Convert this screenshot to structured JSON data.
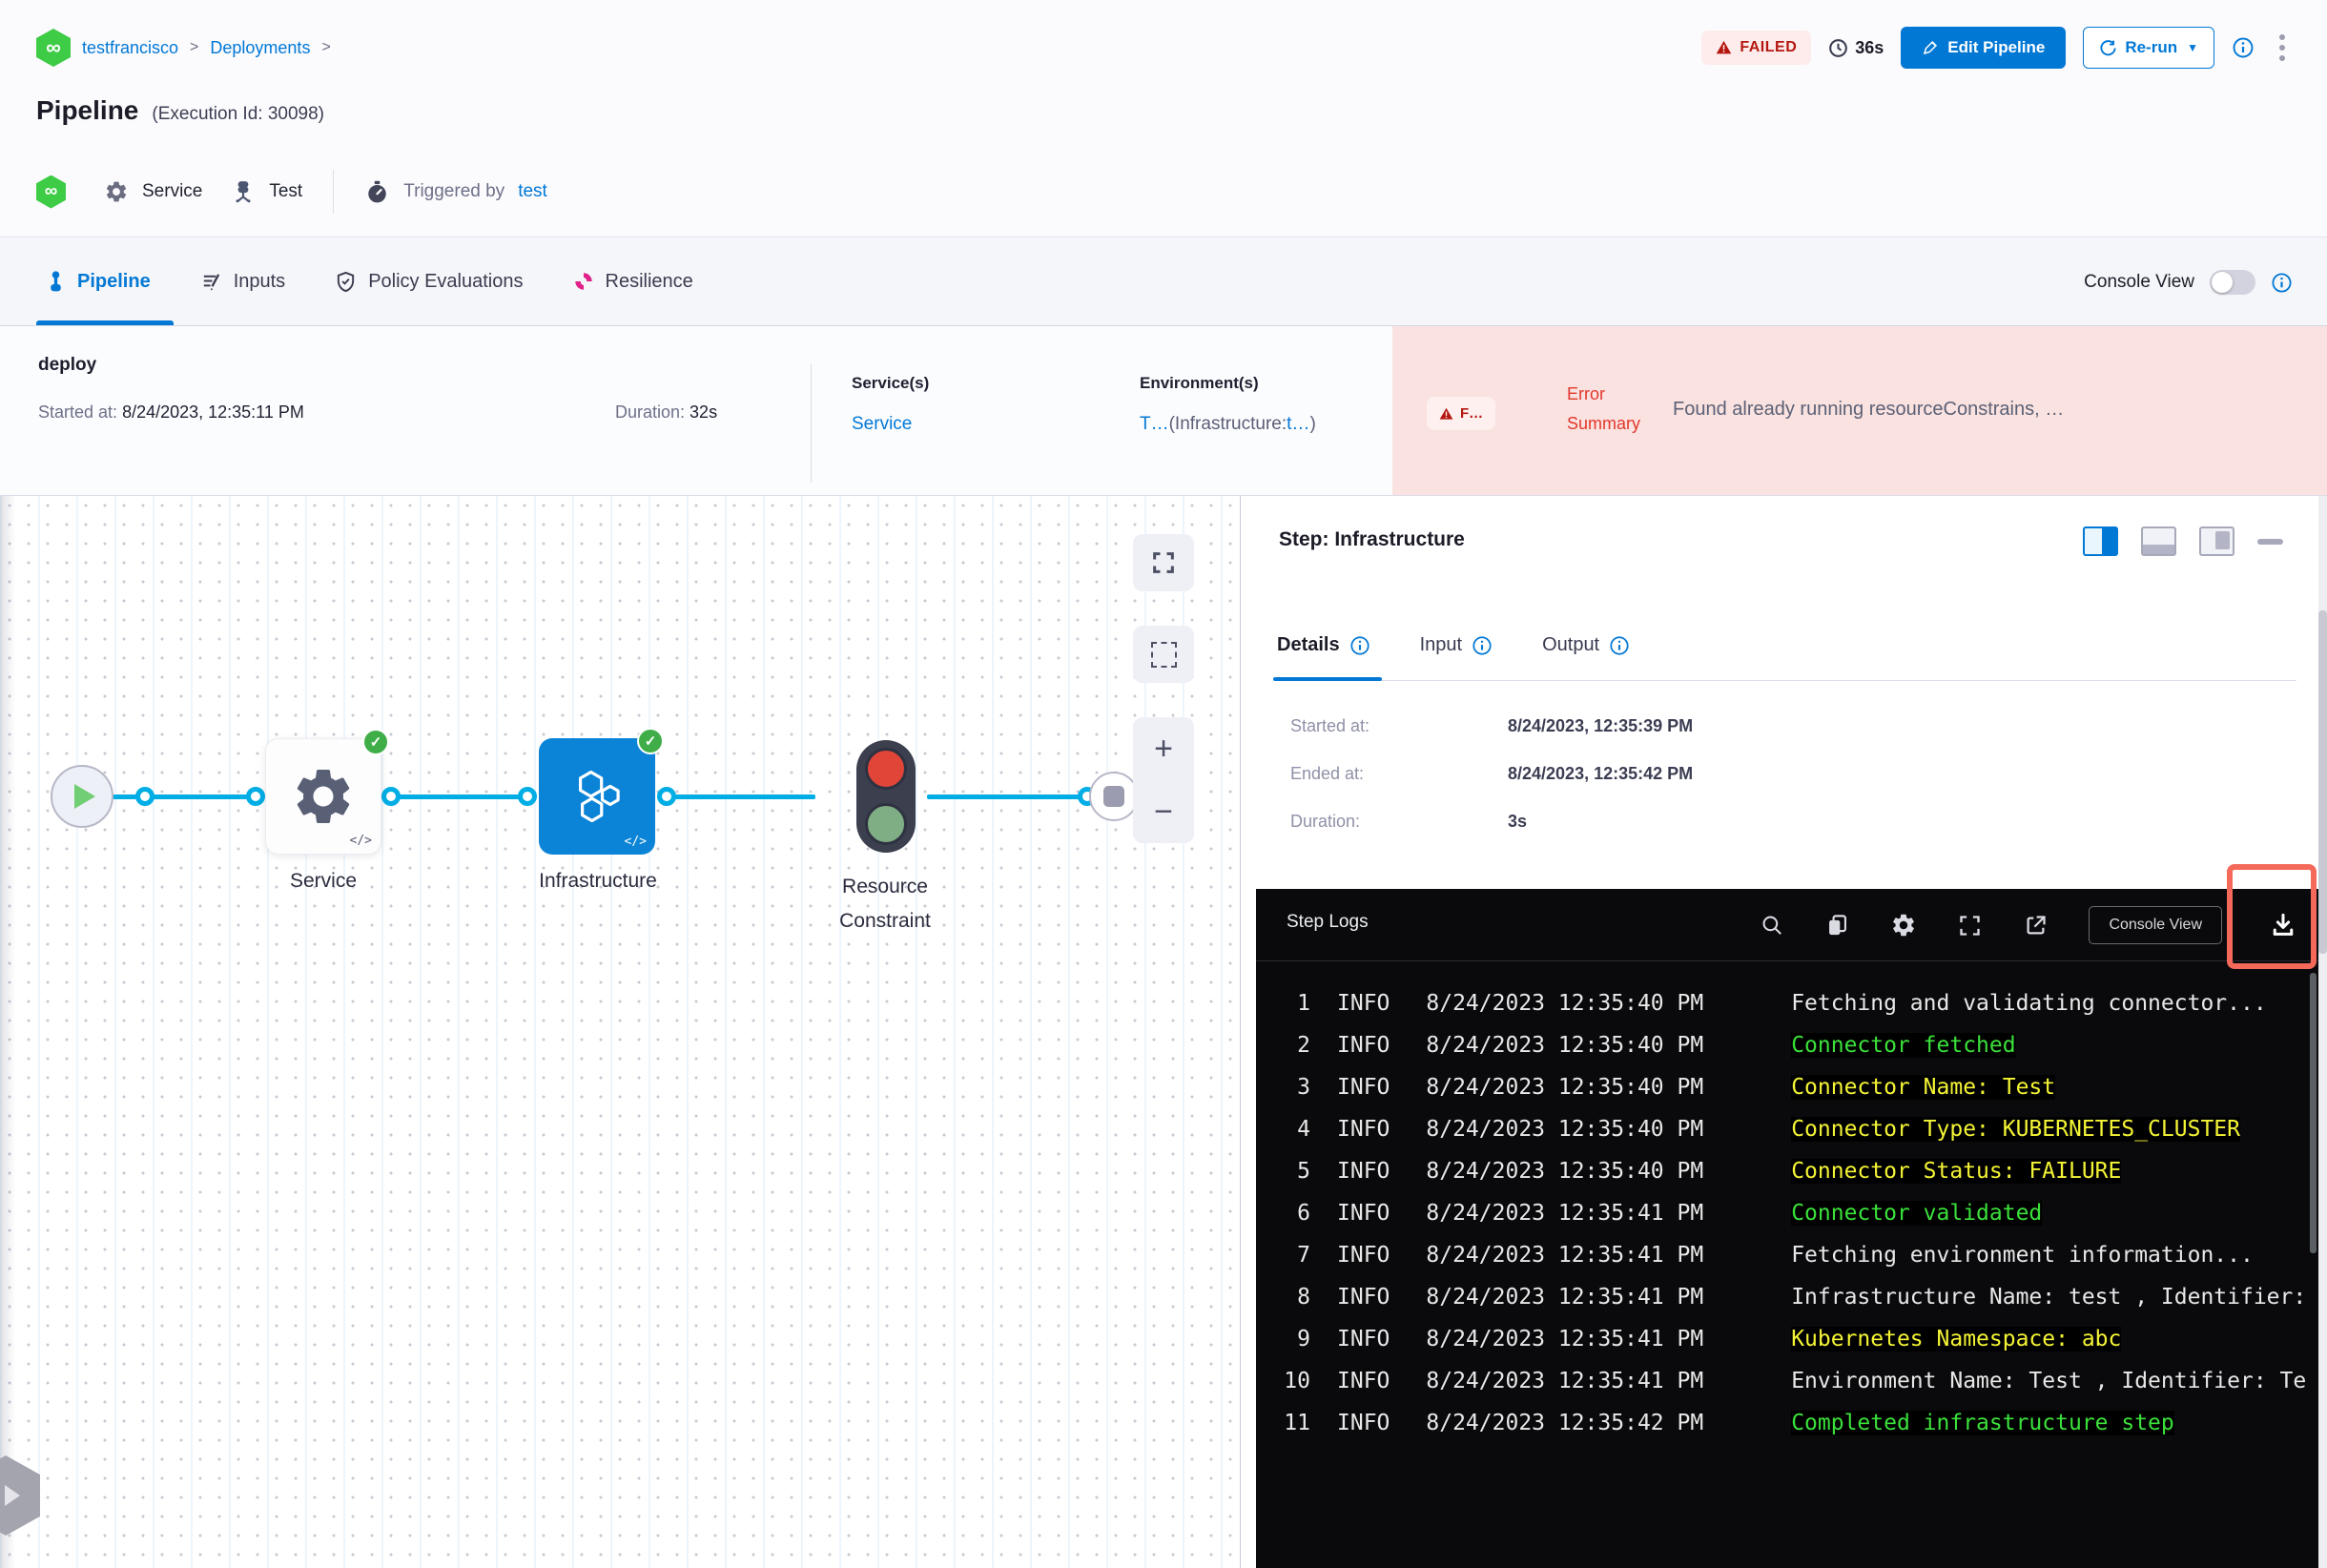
{
  "breadcrumb": {
    "items": [
      "testfrancisco",
      "Deployments"
    ],
    "separator": ">",
    "logo_icon": "harness-infinity-icon"
  },
  "header": {
    "title": "Pipeline",
    "execution_id": "(Execution Id: 30098)",
    "service_label": "Service",
    "environment_label": "Test",
    "triggered_by_prefix": "Triggered by",
    "triggered_by_user": "test",
    "status_badge": "FAILED",
    "total_duration": "36s",
    "edit_button": "Edit Pipeline",
    "rerun_button": "Re-run"
  },
  "tabs": {
    "items": [
      {
        "label": "Pipeline",
        "active": true
      },
      {
        "label": "Inputs",
        "active": false
      },
      {
        "label": "Policy Evaluations",
        "active": false
      },
      {
        "label": "Resilience",
        "active": false
      }
    ],
    "console_view_label": "Console View",
    "console_view_on": false
  },
  "stage_summary": {
    "name": "deploy",
    "started_label": "Started at: ",
    "started_value": "8/24/2023, 12:35:11 PM",
    "duration_label": "Duration: ",
    "duration_value": "32s",
    "services_label": "Service(s)",
    "service_link": "Service",
    "environments_label": "Environment(s)",
    "environment_primary": "T…",
    "environment_infra_prefix": "(Infrastructure:",
    "environment_infra_value": "t…",
    "environment_suffix": ")",
    "error_badge": "F…",
    "error_label": "Error Summary",
    "error_text": "Found already running resourceConstrains, …"
  },
  "graph": {
    "nodes": [
      {
        "label": "Service",
        "status": "success"
      },
      {
        "label": "Infrastructure",
        "status": "success"
      },
      {
        "label": "Resource Constraint",
        "status": "waiting"
      }
    ]
  },
  "step_panel": {
    "title": "Step: Infrastructure",
    "tabs": [
      {
        "label": "Details",
        "active": true
      },
      {
        "label": "Input",
        "active": false
      },
      {
        "label": "Output",
        "active": false
      }
    ],
    "details": [
      {
        "label": "Started at:",
        "value": "8/24/2023, 12:35:39 PM"
      },
      {
        "label": "Ended at:",
        "value": "8/24/2023, 12:35:42 PM"
      },
      {
        "label": "Duration:",
        "value": "3s"
      }
    ]
  },
  "logs": {
    "title": "Step Logs",
    "console_view_button": "Console View",
    "lines": [
      {
        "num": "1",
        "level": "INFO",
        "time": "8/24/2023 12:35:40 PM",
        "msg": "Fetching and validating connector...",
        "color": "default"
      },
      {
        "num": "2",
        "level": "INFO",
        "time": "8/24/2023 12:35:40 PM",
        "msg": "Connector fetched",
        "color": "success"
      },
      {
        "num": "3",
        "level": "INFO",
        "time": "8/24/2023 12:35:40 PM",
        "msg": "Connector Name: Test",
        "color": "highlight"
      },
      {
        "num": "4",
        "level": "INFO",
        "time": "8/24/2023 12:35:40 PM",
        "msg": "Connector Type: KUBERNETES_CLUSTER",
        "color": "highlight"
      },
      {
        "num": "5",
        "level": "INFO",
        "time": "8/24/2023 12:35:40 PM",
        "msg": "Connector Status: FAILURE",
        "color": "highlight"
      },
      {
        "num": "6",
        "level": "INFO",
        "time": "8/24/2023 12:35:41 PM",
        "msg": "Connector validated",
        "color": "success"
      },
      {
        "num": "7",
        "level": "INFO",
        "time": "8/24/2023 12:35:41 PM",
        "msg": "Fetching environment information...",
        "color": "default"
      },
      {
        "num": "8",
        "level": "INFO",
        "time": "8/24/2023 12:35:41 PM",
        "msg": "Infrastructure Name: test , Identifier:",
        "color": "default"
      },
      {
        "num": "9",
        "level": "INFO",
        "time": "8/24/2023 12:35:41 PM",
        "msg": "Kubernetes Namespace: abc",
        "color": "highlight"
      },
      {
        "num": "10",
        "level": "INFO",
        "time": "8/24/2023 12:35:41 PM",
        "msg": "Environment Name: Test , Identifier: Te",
        "color": "default"
      },
      {
        "num": "11",
        "level": "INFO",
        "time": "8/24/2023 12:35:42 PM",
        "msg": "Completed infrastructure step",
        "color": "success"
      }
    ]
  },
  "colors": {
    "accent_blue": "#0278d5",
    "connector_blue": "#00ade4",
    "failed_red": "#b41710",
    "error_bg": "#f9e2e0",
    "success_green": "#3fae48",
    "log_green": "#3be13b",
    "log_yellow": "#f4f436",
    "harness_green": "#3ecb45",
    "resilience_pink": "#e0218a",
    "annotation_red": "#f4695a"
  }
}
